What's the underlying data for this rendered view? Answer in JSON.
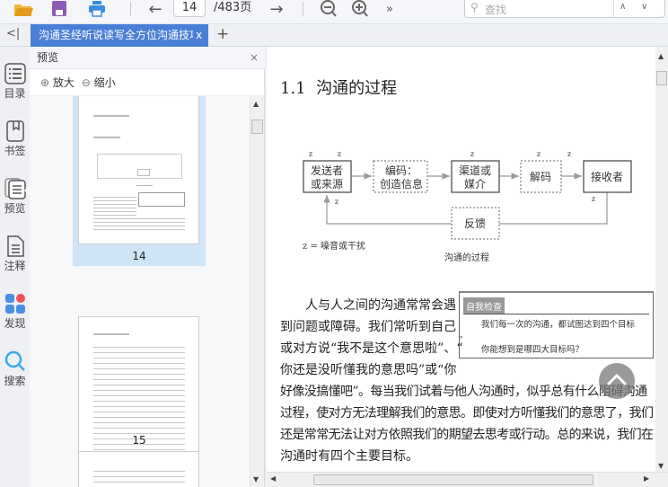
{
  "toolbar": {
    "page_current": "14",
    "page_total": "/483页",
    "search_placeholder": "查找",
    "more": "»"
  },
  "tab": {
    "title": "沟通圣经听说读写全方位沟通技巧",
    "close": "x",
    "add": "+",
    "collapse": "<|"
  },
  "rail": [
    {
      "label": "目录"
    },
    {
      "label": "书签"
    },
    {
      "label": "预览"
    },
    {
      "label": "注释"
    },
    {
      "label": "发现"
    },
    {
      "label": "搜索"
    }
  ],
  "panel": {
    "title": "预览",
    "close": "×",
    "zoom_in": "放大",
    "zoom_out": "缩小",
    "pages": [
      "14",
      "15"
    ]
  },
  "doc": {
    "heading_num": "1.1",
    "heading": "沟通的过程",
    "diagram": {
      "sender": [
        "发送者",
        "或来源"
      ],
      "encode": [
        "编码：",
        "创造信息"
      ],
      "channel": [
        "渠道或",
        "媒介"
      ],
      "decode": "解码",
      "receiver": "接收者",
      "feedback": "反馈",
      "noise_mark": "z",
      "legend": "z = 噪音或干扰",
      "caption": "沟通的过程"
    },
    "sidebox": {
      "title": "自我检查",
      "line1": "我们每一次的沟通，都试图达到四个目标",
      "dot": "。",
      "line2": "你能想到是哪四大目标吗？"
    },
    "para_lines": [
      "人与人之间的沟通常常会遇",
      "到问题或障碍。我们常听到自己",
      "或对方说“我不是这个意思啦”、“",
      "你还是没听懂我的意思吗”或“你",
      "好像没搞懂吧”。每当我们试着与他人沟通时，似乎总有什么阻碍沟通",
      "过程，使对方无法理解我们的意思。即使对方听懂我们的意思了，我们",
      "还是常常无法让对方依照我们的期望去思考或行动。总的来说，我们在",
      "沟通时有四个主要目标。"
    ]
  },
  "colors": {
    "accent": "#4a7fd6",
    "thumb_selected": "#cfe4f7"
  }
}
